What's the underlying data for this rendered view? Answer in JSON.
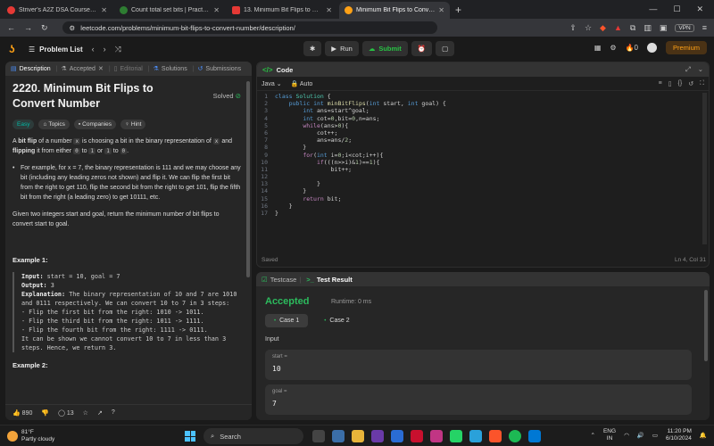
{
  "browser": {
    "tabs": [
      {
        "label": "Striver's A2Z DSA Course/Sheet - Cod",
        "color": "#e53935"
      },
      {
        "label": "Count total set bits | Practice | Geeks",
        "color": "#2e7d32"
      },
      {
        "label": "13. Minimum Bit Flips to Convert Nu",
        "color": "#e53935"
      },
      {
        "label": "Minimum Bit Flips to Convert N",
        "color": "#ffa116"
      }
    ],
    "url": "leetcode.com/problems/minimum-bit-flips-to-convert-number/description/",
    "vpn": "VPN"
  },
  "header": {
    "problem_list": "Problem List",
    "run": "Run",
    "submit": "Submit",
    "streak": "0",
    "premium": "Premium"
  },
  "left": {
    "tabs": [
      "Description",
      "Accepted",
      "Editorial",
      "Solutions",
      "Submissions"
    ],
    "title": "2220. Minimum Bit Flips to Convert Number",
    "solved": "Solved",
    "tags": [
      "Easy",
      "Topics",
      "Companies",
      "Hint"
    ],
    "desc1_a": "A ",
    "desc1_b": "bit flip",
    "desc1_c": " of a number ",
    "desc1_x": "x",
    "desc1_d": " is choosing a bit in the binary representation of ",
    "desc1_x2": "x",
    "desc1_e": " and ",
    "desc1_f": "flipping",
    "desc1_g": " it from either ",
    "desc1_0": "0",
    "desc1_h": " to ",
    "desc1_1": "1",
    "desc1_i": " or ",
    "desc1_1b": "1",
    "desc1_j": " to ",
    "desc1_0b": "0",
    "desc1_k": ".",
    "bullet": "For example, for x = 7, the binary representation is 111 and we may choose any bit (including any leading zeros not shown) and flip it. We can flip the first bit from the right to get 110, flip the second bit from the right to get 101, flip the fifth bit from the right (a leading zero) to get 10111, etc.",
    "given": "Given two integers start and goal, return the minimum number of bit flips to convert start to goal.",
    "ex1_title": "Example 1:",
    "ex1_input": "start = 10, goal = 7",
    "ex1_output": "3",
    "ex1_expl": "The binary representation of 10 and 7 are 1010 and 0111 respectively. We can convert 10 to 7 in 3 steps:",
    "ex1_steps": [
      "- Flip the first bit from the right: 1010 -> 1011.",
      "- Flip the third bit from the right: 1011 -> 1111.",
      "- Flip the fourth bit from the right: 1111 -> 0111."
    ],
    "ex1_end": "It can be shown we cannot convert 10 to 7 in less than 3 steps. Hence, we return 3.",
    "ex2_title": "Example 2:",
    "likes": "890",
    "comments": "13"
  },
  "code": {
    "title": "Code",
    "language": "Java",
    "mode": "Auto",
    "lines": [
      "class Solution {",
      "    public int minBitFlips(int start, int goal) {",
      "        int ans=start^goal;",
      "        int cot=0,bit=0,n=ans;",
      "        while(ans>0){",
      "            cot++;",
      "            ans=ans/2;",
      "        }",
      "        for(int i=0;i<cot;i++){",
      "            if(((n>>i)&1)==1){",
      "                bit++;",
      "",
      "            }",
      "        }",
      "        return bit;",
      "    }",
      "}"
    ],
    "saved": "Saved",
    "cursor": "Ln 4, Col 31"
  },
  "test": {
    "tabs": [
      "Testcase",
      "Test Result"
    ],
    "status": "Accepted",
    "runtime": "Runtime: 0 ms",
    "cases": [
      "Case 1",
      "Case 2"
    ],
    "input_label": "Input",
    "inputs": [
      {
        "name": "start =",
        "value": "10"
      },
      {
        "name": "goal =",
        "value": "7"
      }
    ]
  },
  "taskbar": {
    "temp": "81°F",
    "weather": "Partly cloudy",
    "search": "Search",
    "lang1": "ENG",
    "lang2": "IN",
    "time": "11:20 PM",
    "date": "6/10/2024"
  }
}
